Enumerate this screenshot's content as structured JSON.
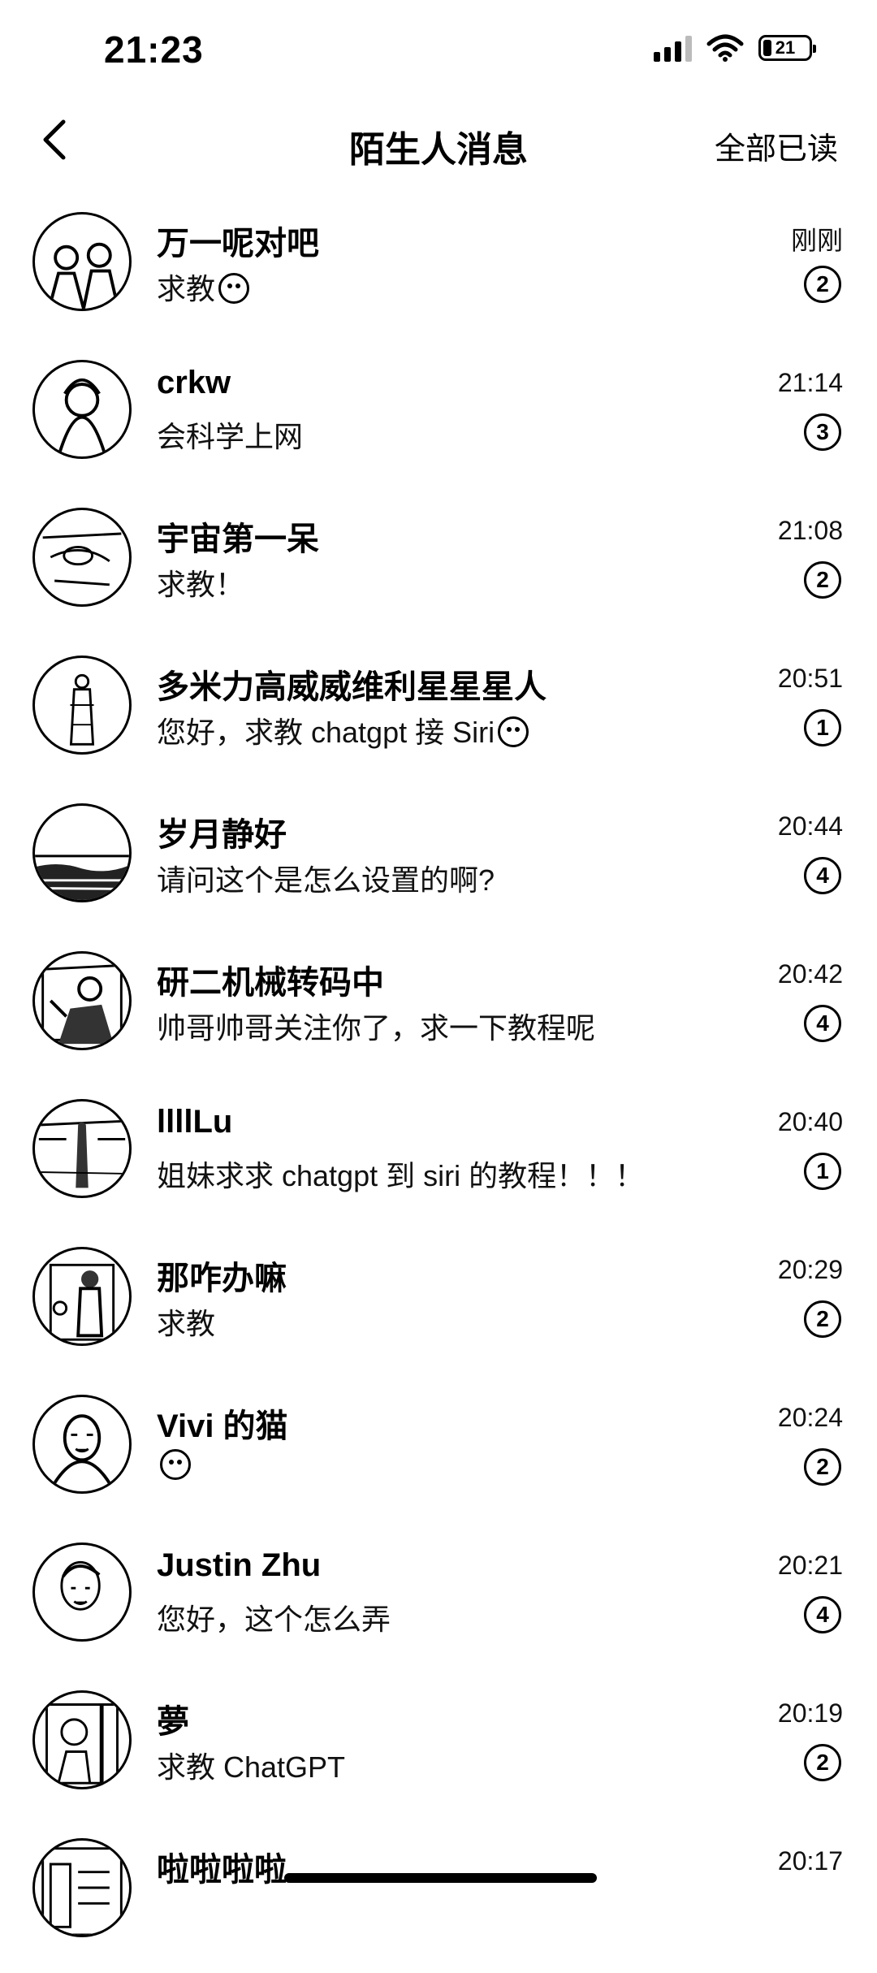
{
  "status_bar": {
    "time": "21:23",
    "battery_level": "21",
    "icons": [
      "signal-icon",
      "wifi-icon",
      "battery-icon"
    ]
  },
  "nav": {
    "title": "陌生人消息",
    "back_icon": "chevron-left-icon",
    "mark_all_read": "全部已读"
  },
  "conversations": [
    {
      "name": "万一呢对吧",
      "message": "求教",
      "emoji": true,
      "time": "刚刚",
      "unread": "②"
    },
    {
      "name": "crkw",
      "message": "会科学上网",
      "emoji": false,
      "time": "21:14",
      "unread": "③"
    },
    {
      "name": "宇宙第一呆",
      "message": "求教！",
      "emoji": false,
      "time": "21:08",
      "unread": "②"
    },
    {
      "name": "多米力高威威维利星星星人",
      "message": "您好，求教 chatgpt 接 Siri",
      "emoji": true,
      "time": "20:51",
      "unread": "①"
    },
    {
      "name": "岁月静好",
      "message": "请问这个是怎么设置的啊?",
      "emoji": false,
      "time": "20:44",
      "unread": "④"
    },
    {
      "name": "研二机械转码中",
      "message": "帅哥帅哥关注你了，求一下教程呢",
      "emoji": false,
      "time": "20:42",
      "unread": "④"
    },
    {
      "name": "llllLu",
      "message": "姐妹求求 chatgpt 到 siri 的教程！！！",
      "emoji": false,
      "time": "20:40",
      "unread": "①"
    },
    {
      "name": "那咋办嘛",
      "message": "求教",
      "emoji": false,
      "time": "20:29",
      "unread": "②"
    },
    {
      "name": "Vivi 的猫",
      "message": "",
      "emoji": true,
      "time": "20:24",
      "unread": "②"
    },
    {
      "name": "Justin Zhu",
      "message": "您好，这个怎么弄",
      "emoji": false,
      "time": "20:21",
      "unread": "④"
    },
    {
      "name": "夢",
      "message": "求教 ChatGPT",
      "emoji": false,
      "time": "20:19",
      "unread": "②"
    },
    {
      "name": "啦啦啦啦",
      "message": "",
      "emoji": false,
      "time": "20:17",
      "unread": ""
    }
  ]
}
